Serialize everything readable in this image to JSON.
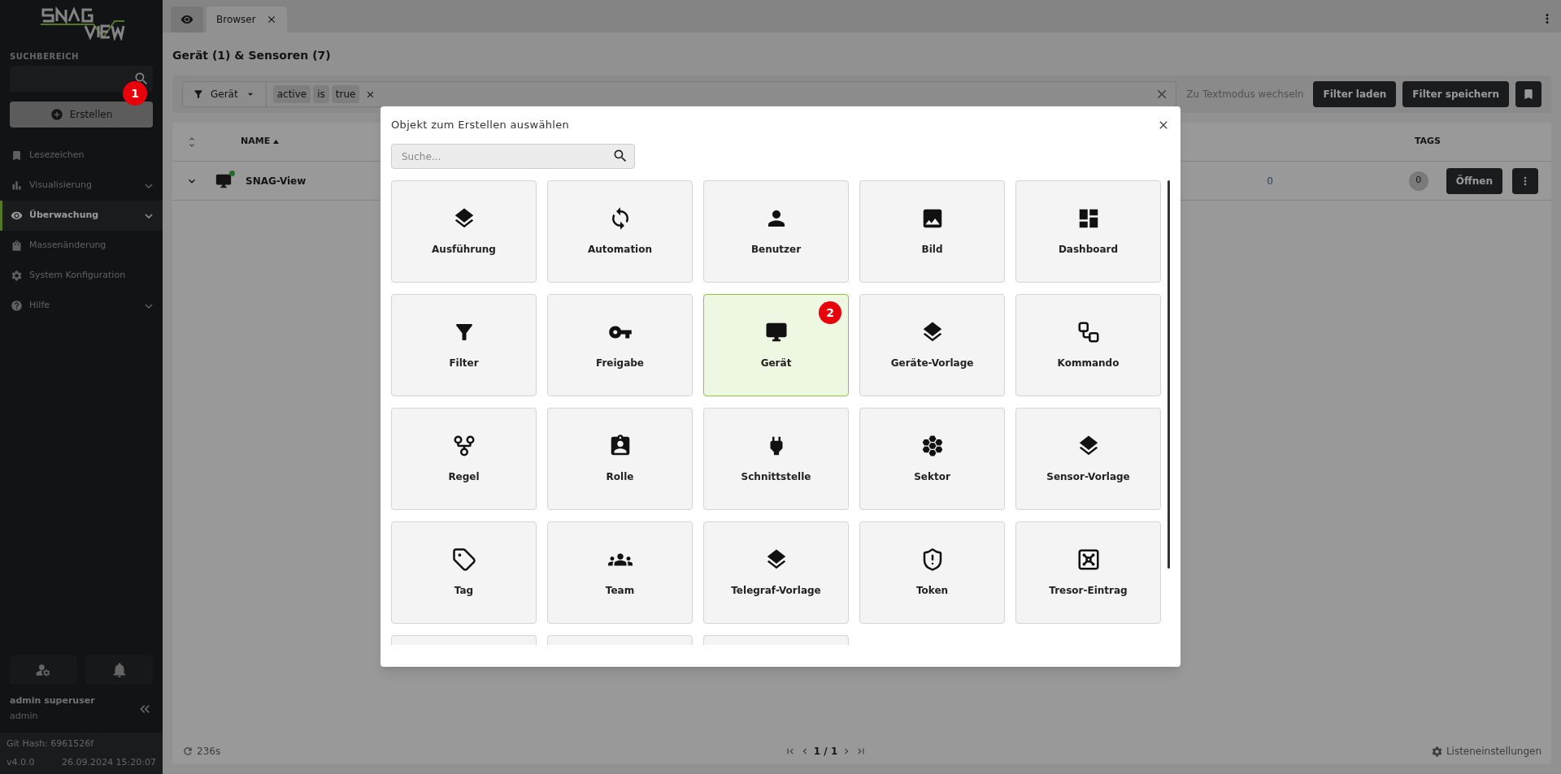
{
  "sidebar": {
    "search_label": "SUCHBEREICH",
    "create_button": "Erstellen",
    "create_marker": "1",
    "items": [
      {
        "label": "Lesezeichen",
        "selected": false,
        "expandable": false
      },
      {
        "label": "Visualisierung",
        "selected": false,
        "expandable": true
      },
      {
        "label": "Überwachung",
        "selected": true,
        "expandable": true
      },
      {
        "label": "Massenänderung",
        "selected": false,
        "expandable": false
      },
      {
        "label": "System Konfiguration",
        "selected": false,
        "expandable": false
      },
      {
        "label": "Hilfe",
        "selected": false,
        "expandable": true
      }
    ],
    "user": {
      "name": "admin superuser",
      "login": "admin"
    },
    "git_hash": "Git Hash: 6961526f",
    "version": "v4.0.0",
    "build_date": "26.09.2024 15:20:07"
  },
  "tabs": [
    {
      "kind": "icon",
      "selected": false,
      "closable": false
    },
    {
      "kind": "text",
      "label": "Browser",
      "selected": true,
      "closable": true
    }
  ],
  "page_title": "Gerät (1) & Sensoren (7)",
  "filter": {
    "type": "Gerät",
    "chips": [
      "active",
      "is",
      "true"
    ],
    "text_mode": "Zu Textmodus wechseln",
    "load": "Filter laden",
    "save": "Filter speichern"
  },
  "table": {
    "columns": [
      "NAME",
      "TAGS"
    ],
    "rows": [
      {
        "name": "SNAG-View",
        "online": true,
        "partial_cell": "0",
        "tags": "0",
        "open": "Öffnen"
      }
    ]
  },
  "footer": {
    "refresh": "236s",
    "pages": "1 / 1",
    "settings": "Listeneinstellungen"
  },
  "modal": {
    "title": "Objekt zum Erstellen auswählen",
    "search_placeholder": "Suche...",
    "marker": "2",
    "tiles": [
      {
        "label": "Ausführung",
        "selected": false
      },
      {
        "label": "Automation",
        "selected": false
      },
      {
        "label": "Benutzer",
        "selected": false
      },
      {
        "label": "Bild",
        "selected": false
      },
      {
        "label": "Dashboard",
        "selected": false
      },
      {
        "label": "Filter",
        "selected": false
      },
      {
        "label": "Freigabe",
        "selected": false
      },
      {
        "label": "Gerät",
        "selected": true
      },
      {
        "label": "Geräte-Vorlage",
        "selected": false
      },
      {
        "label": "Kommando",
        "selected": false
      },
      {
        "label": "Regel",
        "selected": false
      },
      {
        "label": "Rolle",
        "selected": false
      },
      {
        "label": "Schnittstelle",
        "selected": false
      },
      {
        "label": "Sektor",
        "selected": false
      },
      {
        "label": "Sensor-Vorlage",
        "selected": false
      },
      {
        "label": "Tag",
        "selected": false
      },
      {
        "label": "Team",
        "selected": false
      },
      {
        "label": "Telegraf-Vorlage",
        "selected": false
      },
      {
        "label": "Token",
        "selected": false
      },
      {
        "label": "Tresor-Eintrag",
        "selected": false
      },
      {
        "selected": false
      },
      {
        "selected": false
      },
      {
        "selected": false
      }
    ]
  }
}
